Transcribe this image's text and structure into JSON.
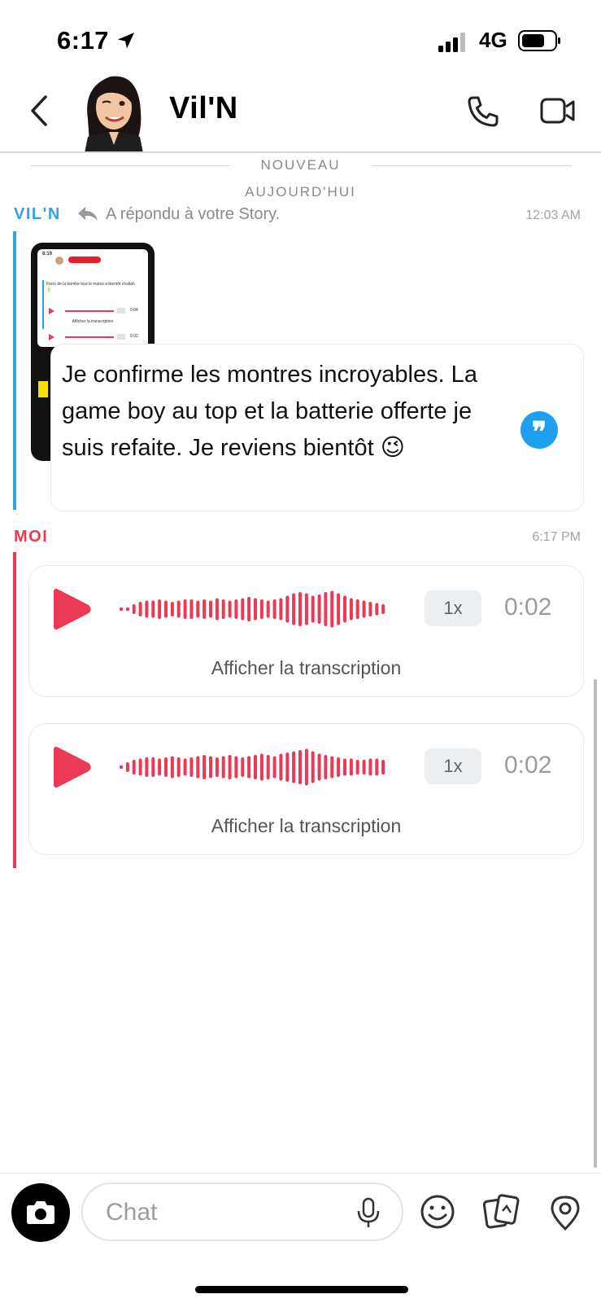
{
  "status_bar": {
    "time": "6:17",
    "network": "4G",
    "battery_level": 0.7
  },
  "header": {
    "contact_name": "Vil'N"
  },
  "separators": {
    "new": "NOUVEAU",
    "today": "AUJOURD'HUI"
  },
  "messages": {
    "story_reply": {
      "sender": "VIL'N",
      "reply_label": "A répondu à votre Story.",
      "timestamp": "12:03 AM",
      "story_preview": {
        "text": "Frero de la bombe tout le matos a bientôt challah 👌",
        "duration_1": "0:04",
        "duration_2": "0:02",
        "speed": "1x",
        "transcription": "Afficher la transcription"
      },
      "text": "Je confirme les montres incroyables. La game boy au top et la batterie offerte je suis refaite. Je reviens bientôt 😉",
      "quote_glyph": "❞"
    },
    "my_group": {
      "sender": "MOI",
      "timestamp": "6:17 PM",
      "voice_notes": [
        {
          "speed": "1x",
          "duration": "0:02",
          "transcription_label": "Afficher la transcription"
        },
        {
          "speed": "1x",
          "duration": "0:02",
          "transcription_label": "Afficher la transcription"
        }
      ]
    }
  },
  "composer": {
    "placeholder": "Chat"
  },
  "colors": {
    "accent_blue": "#2ba5e8",
    "accent_red": "#ea3a55",
    "quote_blue": "#1f9ff0"
  }
}
